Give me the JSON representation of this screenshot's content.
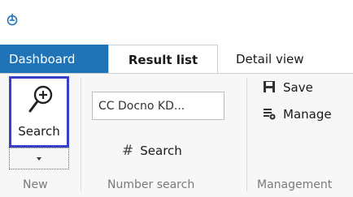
{
  "window": {
    "app_icon": "app-logo-icon"
  },
  "tabs": [
    {
      "label": "Dashboard",
      "state": "highlighted"
    },
    {
      "label": "Result list",
      "state": "selected"
    },
    {
      "label": "Detail view",
      "state": "normal"
    }
  ],
  "ribbon": {
    "new_group": {
      "search_button_label": "Search",
      "group_label": "New",
      "icon": "magnifier-plus-icon"
    },
    "number_search_group": {
      "input_value": "CC Docno KD...",
      "search_label": "Search",
      "group_label": "Number search",
      "icon": "hash-icon"
    },
    "management_group": {
      "save_label": "Save",
      "manage_label": "Manage",
      "group_label": "Management",
      "icons": [
        "save-icon",
        "manage-icon"
      ]
    }
  },
  "colors": {
    "accent": "#1f74b8",
    "focus_border": "#3b3fc7"
  }
}
